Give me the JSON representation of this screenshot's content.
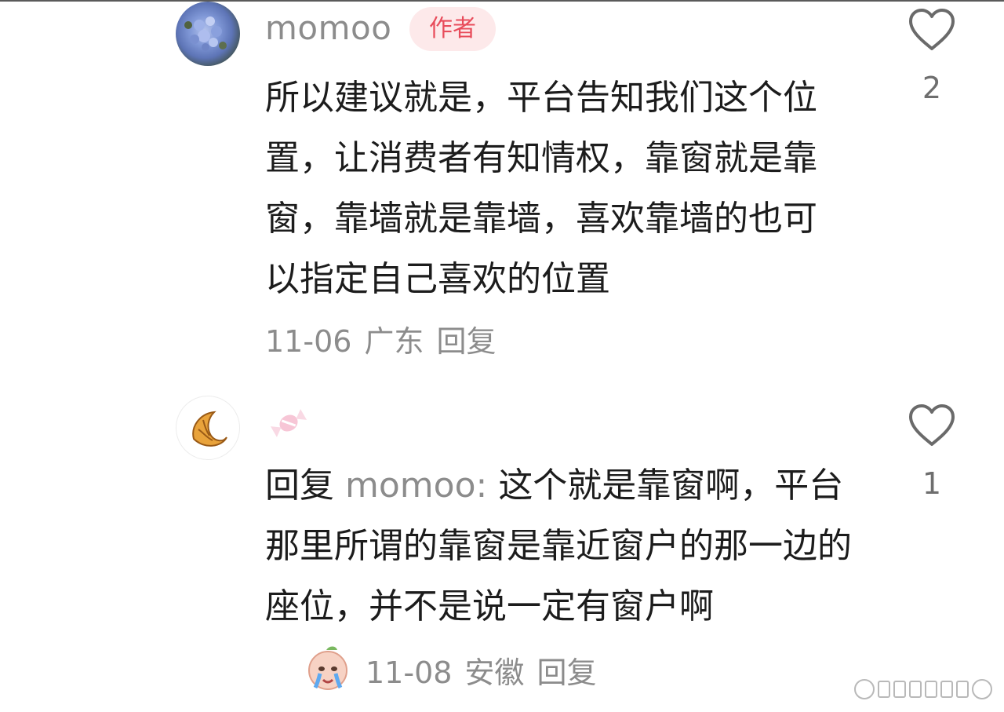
{
  "comments": [
    {
      "username": "momoo",
      "badge": "作者",
      "avatar": "hydrangea-photo",
      "text": "所以建议就是，平台告知我们这个位置，让消费者有知情权，靠窗就是靠窗，靠墙就是靠墙，喜欢靠墙的也可以指定自己喜欢的位置",
      "date": "11-06",
      "location": "广东",
      "reply_label": "回复",
      "likes": "2"
    },
    {
      "username": "",
      "username_icon": "candy-emoji",
      "avatar": "croissant-icon",
      "reply_prefix": "回复",
      "reply_target": "momoo:",
      "text": "这个就是靠窗啊，平台那里所谓的靠窗是靠近窗户的那一边的座位，并不是说一定有窗户啊",
      "inline_sticker": "crying-peach-sticker",
      "date": "11-08",
      "location": "安徽",
      "reply_label": "回复",
      "likes": "1"
    }
  ],
  "colors": {
    "text": "#1c1c1c",
    "meta": "#8c8c8c",
    "badge_bg": "#fde9ea",
    "badge_text": "#e84c5b"
  }
}
